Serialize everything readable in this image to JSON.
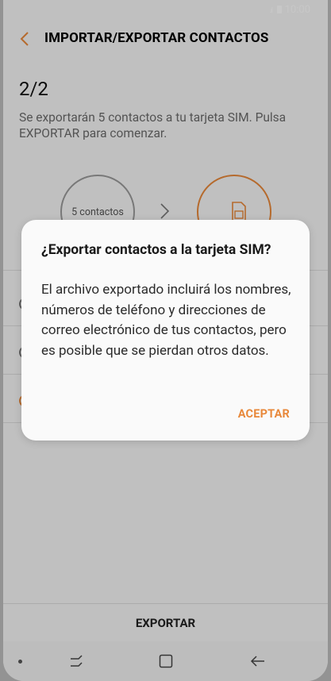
{
  "status": {
    "time": "10:00",
    "signal": ".ıl"
  },
  "app": {
    "title": "IMPORTAR/EXPORTAR CONTACTOS"
  },
  "step": {
    "label": "2/2",
    "description": "Se exportarán 5 contactos a tu tarjeta SIM. Pulsa EXPORTAR para comenzar."
  },
  "diagram": {
    "source_label": "5 contactos"
  },
  "bottom": {
    "export_label": "EXPORTAR"
  },
  "dialog": {
    "title": "¿Exportar contactos a la tarjeta SIM?",
    "body": "El archivo exportado incluirá los nombres, números de teléfono y direcciones de correo electrónico de tus contactos, pero es posible que se pierdan otros datos.",
    "accept_label": "ACEPTAR"
  },
  "colors": {
    "accent": "#e8883a",
    "dim": "rgba(0,0,0,0.22)"
  },
  "icons": [
    "back-arrow-icon",
    "chevron-right-icon",
    "sim-card-icon",
    "recents-icon",
    "home-icon",
    "back-nav-icon"
  ]
}
